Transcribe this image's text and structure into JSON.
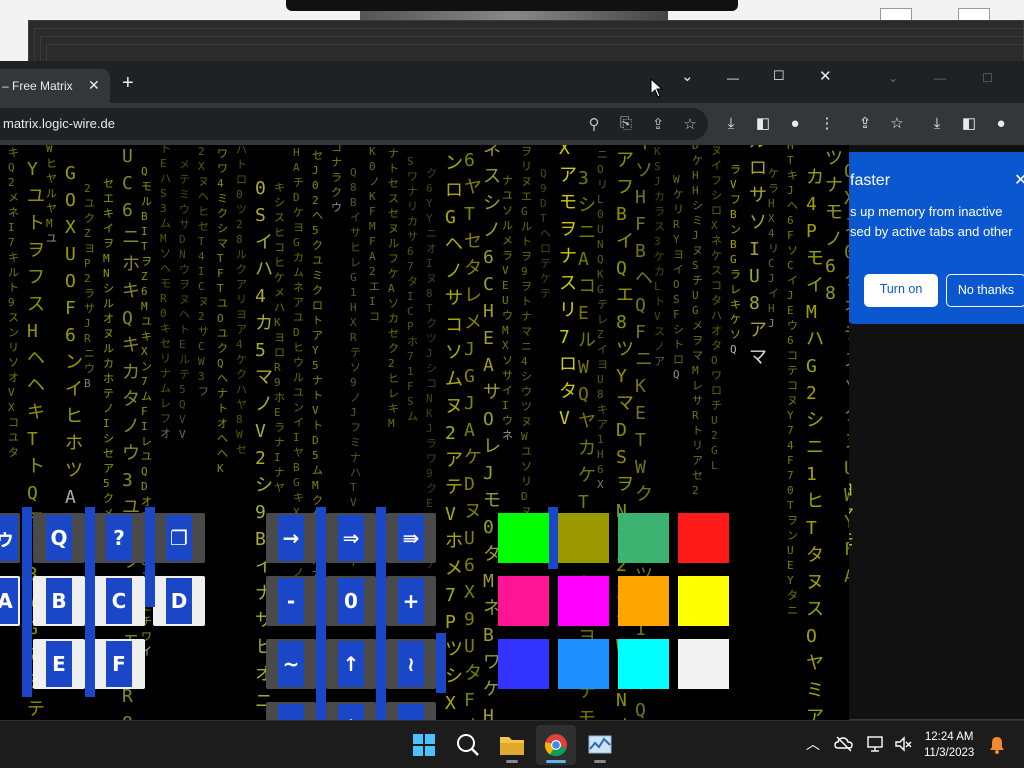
{
  "browser": {
    "tab_title": "– Free Matrix",
    "tab_close": "✕",
    "new_tab": "+",
    "url": "matrix.logic-wire.de",
    "window_controls": {
      "tab_search": "⌄",
      "minimize": "—",
      "maximize": "☐",
      "close": "✕"
    },
    "omnibox_icons": [
      "search-icon",
      "install-app-icon",
      "share-icon",
      "bookmark-star-icon"
    ],
    "toolbar_icons": [
      "download-icon",
      "side-panel-icon",
      "profile-icon",
      "menu-icon"
    ]
  },
  "back_window": {
    "popup": {
      "title": "faster",
      "close": "✕",
      "body_line1": "s up memory from inactive",
      "body_line2": "sed by active tabs and other",
      "turn_on": "Turn on",
      "no_thanks": "No thanks"
    }
  },
  "matrix": {
    "char_colors": [
      "#e6e600",
      "#d4d400",
      "#bfbf3a",
      "#ffffff"
    ],
    "highlight_color": "#1a47c8",
    "keypad_letters": [
      "ゥ",
      "Q",
      "?",
      "❐",
      "A",
      "B",
      "C",
      "D",
      "E",
      "F"
    ],
    "keypad_arrows": [
      "→",
      "⇒",
      "⇛",
      "-",
      "0",
      "+",
      "~",
      "↑",
      "≀",
      "←",
      "↓",
      "→"
    ],
    "swatches": [
      "#00ff00",
      "#9a9a00",
      "#3cb371",
      "#ff1a1a",
      "#ff1493",
      "#ff00ff",
      "#ffa500",
      "#ffff00",
      "#3333ff",
      "#1e90ff",
      "#00ffff",
      "#f2f2f2"
    ]
  },
  "taskbar": {
    "apps": [
      {
        "name": "start-button-icon",
        "active": false
      },
      {
        "name": "search-icon",
        "active": false
      },
      {
        "name": "file-explorer-icon",
        "active": false
      },
      {
        "name": "chrome-icon",
        "active": true
      },
      {
        "name": "task-manager-icon",
        "active": false
      }
    ],
    "time": "12:24 AM",
    "date": "11/3/2023"
  }
}
